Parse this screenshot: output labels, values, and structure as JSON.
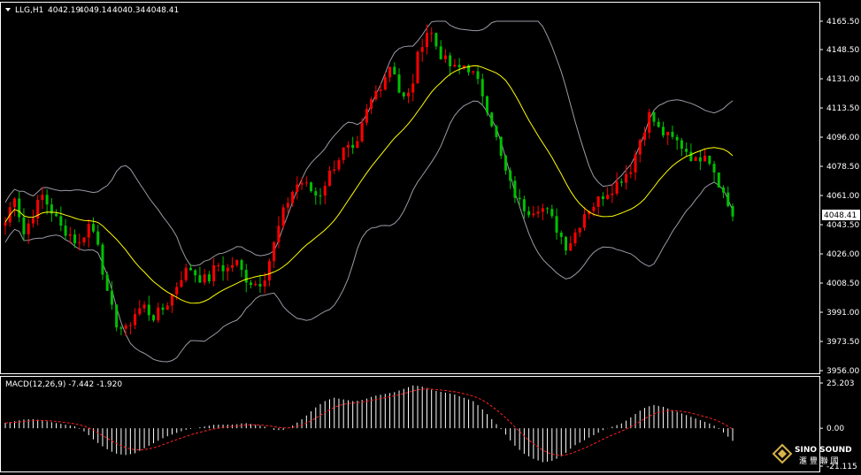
{
  "symbol_header": {
    "symbol": "LLG,H1",
    "open": "4042.19",
    "high": "4049.14",
    "low": "4040.34",
    "close": "4048.41"
  },
  "price_axis": {
    "ticks": [
      "4165.50",
      "4148.50",
      "4131.00",
      "4113.50",
      "4096.00",
      "4078.50",
      "4061.00",
      "4043.50",
      "4026.00",
      "4008.50",
      "3991.00",
      "3973.50",
      "3956.00"
    ],
    "current_price": "4048.41"
  },
  "macd": {
    "label": "MACD(12,26,9) -7.442 -1.920",
    "ticks": [
      "25.203",
      "0.00",
      "-21.115"
    ]
  },
  "watermark": {
    "brand": "SINO SOUND",
    "subtitle": "滙 豐 聯 國"
  },
  "colors": {
    "background": "#000000",
    "bull": "#00c000",
    "bear": "#ff0000",
    "band": "#9a9aa6",
    "ma": "#ffff00",
    "macd_hist": "#ffffff",
    "signal": "#ff2020",
    "axis": "#ffffff"
  },
  "chart_data": [
    {
      "type": "candlestick",
      "title": "LLG,H1",
      "ylim": [
        3956.0,
        4165.5
      ],
      "overlays": [
        "Bollinger Bands",
        "Moving Average"
      ],
      "last_close": 4048.41,
      "close_path": [
        4045,
        4062,
        4038,
        4050,
        4061,
        4052,
        4042,
        4038,
        4031,
        4044,
        4036,
        4002,
        3985,
        3979,
        3990,
        3995,
        3988,
        3992,
        4000,
        4012,
        4018,
        4012,
        4010,
        4020,
        4016,
        4022,
        4012,
        4008,
        4010,
        4028,
        4048,
        4062,
        4070,
        4065,
        4060,
        4072,
        4082,
        4090,
        4085,
        4108,
        4121,
        4130,
        4142,
        4118,
        4122,
        4150,
        4162,
        4148,
        4140,
        4136,
        4140,
        4132,
        4120,
        4102,
        4080,
        4065,
        4055,
        4052,
        4055,
        4050,
        4040,
        4030,
        4040,
        4052,
        4056,
        4062,
        4066,
        4072,
        4078,
        4096,
        4110,
        4100,
        4096,
        4093,
        4088,
        4081,
        4088,
        4076,
        4062,
        4048
      ]
    },
    {
      "type": "bar",
      "title": "MACD(12,26,9)",
      "ylim": [
        -21.115,
        25.203
      ],
      "macd_value": -7.442,
      "signal_value": -1.92,
      "macd_path": [
        3,
        4,
        5,
        5,
        4,
        3,
        2,
        1,
        -2,
        -7,
        -11,
        -14,
        -15,
        -14,
        -11,
        -8,
        -5,
        -3,
        -1,
        0,
        1,
        2,
        2,
        2,
        3,
        2,
        1,
        -1,
        -1,
        2,
        6,
        11,
        15,
        17,
        16,
        15,
        16,
        18,
        19,
        20,
        22,
        24,
        23,
        21,
        20,
        19,
        17,
        15,
        10,
        4,
        -2,
        -9,
        -14,
        -17,
        -19,
        -18,
        -15,
        -10,
        -7,
        -4,
        -1,
        1,
        3,
        7,
        11,
        13,
        12,
        10,
        8,
        6,
        4,
        2,
        -2,
        -7
      ]
    }
  ]
}
